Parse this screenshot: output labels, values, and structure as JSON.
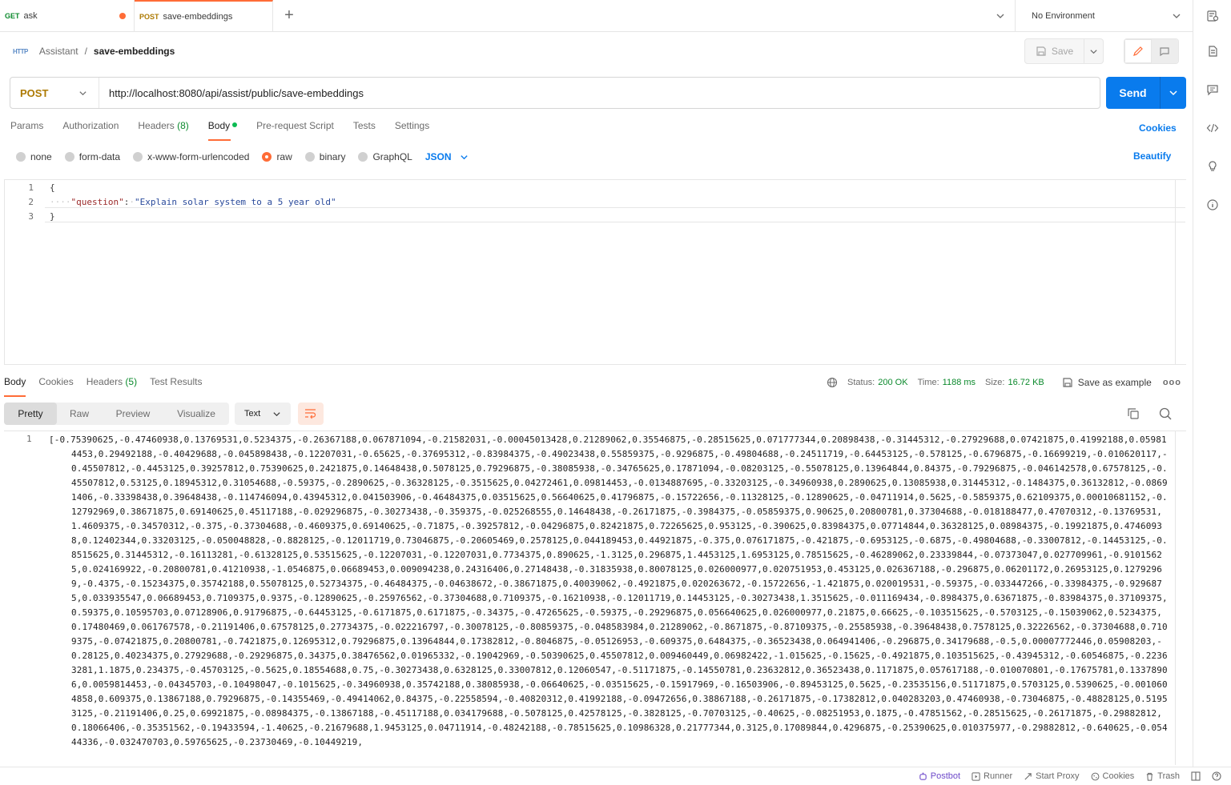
{
  "tabs": [
    {
      "method": "GET",
      "method_color": "#0c8a2d",
      "name": "ask"
    },
    {
      "method": "POST",
      "method_color": "#ad7a03",
      "name": "save-embeddings"
    }
  ],
  "environment": "No Environment",
  "breadcrumb": {
    "protocol_badge": "HTTP",
    "collection": "Assistant",
    "separator": "/",
    "request": "save-embeddings"
  },
  "toolbar": {
    "save_label": "Save"
  },
  "request": {
    "method": "POST",
    "url": "http://localhost:8080/api/assist/public/save-embeddings",
    "send_label": "Send"
  },
  "request_tabs": [
    {
      "label": "Params"
    },
    {
      "label": "Authorization"
    },
    {
      "label": "Headers",
      "count": "(8)"
    },
    {
      "label": "Body",
      "active": true
    },
    {
      "label": "Pre-request Script"
    },
    {
      "label": "Tests"
    },
    {
      "label": "Settings"
    }
  ],
  "cookies_link": "Cookies",
  "body_types": [
    "none",
    "form-data",
    "x-www-form-urlencoded",
    "raw",
    "binary",
    "GraphQL"
  ],
  "body_type_selected": "raw",
  "body_format": "JSON",
  "beautify_label": "Beautify",
  "editor_lines": [
    {
      "num": "1",
      "text": "{"
    },
    {
      "num": "2",
      "key": "\"question\"",
      "value": "\"Explain solar system to a 5 year old\""
    },
    {
      "num": "3",
      "text": "}"
    }
  ],
  "response_tabs": [
    {
      "label": "Body",
      "active": true
    },
    {
      "label": "Cookies"
    },
    {
      "label": "Headers",
      "count": "(5)"
    },
    {
      "label": "Test Results"
    }
  ],
  "response_status": {
    "status_label": "Status:",
    "status": "200 OK",
    "time_label": "Time:",
    "time": "1188 ms",
    "size_label": "Size:",
    "size": "16.72 KB",
    "save_example": "Save as example",
    "more": "ooo"
  },
  "response_views": [
    "Pretty",
    "Raw",
    "Preview",
    "Visualize"
  ],
  "response_format": "Text",
  "response_line_number": "1",
  "response_text": "[-0.75390625,-0.47460938,0.13769531,0.5234375,-0.26367188,0.067871094,-0.21582031,-0.00045013428,0.21289062,0.35546875,-0.28515625,0.071777344,0.20898438,-0.31445312,-0.27929688,0.07421875,0.41992188,0.059814453,0.29492188,-0.40429688,-0.045898438,-0.12207031,-0.65625,-0.37695312,-0.83984375,-0.49023438,0.55859375,-0.9296875,-0.49804688,-0.24511719,-0.64453125,-0.578125,-0.6796875,-0.16699219,-0.010620117,-0.45507812,-0.4453125,0.39257812,0.75390625,0.2421875,0.14648438,0.5078125,0.79296875,-0.38085938,-0.34765625,0.17871094,-0.08203125,-0.55078125,0.13964844,0.84375,-0.79296875,-0.046142578,0.67578125,-0.45507812,0.53125,0.18945312,0.31054688,-0.59375,-0.2890625,-0.36328125,-0.3515625,0.04272461,0.09814453,-0.0134887695,-0.33203125,-0.34960938,0.2890625,0.13085938,0.31445312,-0.1484375,0.36132812,-0.08691406,-0.33398438,0.39648438,-0.114746094,0.43945312,0.041503906,-0.46484375,0.03515625,0.56640625,0.41796875,-0.15722656,-0.11328125,-0.12890625,-0.04711914,0.5625,-0.5859375,0.62109375,0.00010681152,-0.12792969,0.38671875,0.69140625,0.45117188,-0.029296875,-0.30273438,-0.359375,-0.025268555,0.14648438,-0.26171875,-0.3984375,-0.05859375,0.90625,0.20800781,0.37304688,-0.018188477,0.47070312,-0.13769531,1.4609375,-0.34570312,-0.375,-0.37304688,-0.4609375,0.69140625,-0.71875,-0.39257812,-0.04296875,0.82421875,0.72265625,0.953125,-0.390625,0.83984375,0.07714844,0.36328125,0.08984375,-0.19921875,0.47460938,0.12402344,0.33203125,-0.050048828,-0.8828125,-0.12011719,0.73046875,-0.20605469,0.2578125,0.044189453,0.44921875,-0.375,0.076171875,-0.421875,-0.6953125,-0.6875,-0.49804688,-0.33007812,-0.14453125,-0.8515625,0.31445312,-0.16113281,-0.61328125,0.53515625,-0.12207031,-0.12207031,0.7734375,0.890625,-1.3125,0.296875,1.4453125,1.6953125,0.78515625,-0.46289062,0.23339844,-0.07373047,0.027709961,-0.91015625,0.024169922,-0.20800781,0.41210938,-1.0546875,0.06689453,0.009094238,0.24316406,0.27148438,-0.31835938,0.80078125,0.026000977,0.020751953,0.453125,0.026367188,-0.296875,0.06201172,0.26953125,0.12792969,-0.4375,-0.15234375,0.35742188,0.55078125,0.52734375,-0.46484375,-0.04638672,-0.38671875,0.40039062,-0.4921875,0.020263672,-0.15722656,-1.421875,0.020019531,-0.59375,-0.033447266,-0.33984375,-0.9296875,0.033935547,0.06689453,0.7109375,0.9375,-0.12890625,-0.25976562,-0.37304688,0.7109375,-0.16210938,-0.12011719,0.14453125,-0.30273438,1.3515625,-0.011169434,-0.8984375,0.63671875,-0.83984375,0.37109375,0.59375,0.10595703,0.07128906,0.91796875,-0.64453125,-0.6171875,0.6171875,-0.34375,-0.47265625,-0.59375,-0.29296875,0.056640625,0.026000977,0.21875,0.66625,-0.103515625,-0.5703125,-0.15039062,0.5234375,0.17480469,0.061767578,-0.21191406,0.67578125,0.27734375,-0.022216797,-0.30078125,-0.80859375,-0.048583984,0.21289062,-0.8671875,-0.87109375,-0.25585938,-0.39648438,0.7578125,0.32226562,-0.37304688,0.7109375,-0.07421875,0.20800781,-0.7421875,0.12695312,0.79296875,0.13964844,0.17382812,-0.8046875,-0.05126953,-0.609375,0.6484375,-0.36523438,0.064941406,-0.296875,0.34179688,-0.5,0.00007772446,0.05908203,-0.28125,0.40234375,0.27929688,-0.29296875,0.34375,0.38476562,0.01965332,-0.19042969,-0.50390625,0.45507812,0.009460449,0.06982422,-1.015625,-0.15625,-0.4921875,0.103515625,-0.43945312,-0.60546875,-0.22363281,1.1875,0.234375,-0.45703125,-0.5625,0.18554688,0.75,-0.30273438,0.6328125,0.33007812,0.12060547,-0.51171875,-0.14550781,0.23632812,0.36523438,0.1171875,0.057617188,-0.010070801,-0.17675781,0.13378906,0.0059814453,-0.04345703,-0.10498047,-0.1015625,-0.34960938,0.35742188,0.38085938,-0.06640625,-0.03515625,-0.15917969,-0.16503906,-0.89453125,0.5625,-0.23535156,0.51171875,0.5703125,0.5390625,-0.0010604858,0.609375,0.13867188,0.79296875,-0.14355469,-0.49414062,0.84375,-0.22558594,-0.40820312,0.41992188,-0.09472656,0.38867188,-0.26171875,-0.17382812,0.040283203,0.47460938,-0.73046875,-0.48828125,0.51953125,-0.21191406,0.25,0.69921875,-0.08984375,-0.13867188,-0.45117188,0.034179688,-0.5078125,0.42578125,-0.3828125,-0.70703125,-0.40625,-0.08251953,0.1875,-0.47851562,-0.28515625,-0.26171875,-0.29882812,0.18066406,-0.35351562,-0.19433594,-1.40625,-0.21679688,1.9453125,0.04711914,-0.48242188,-0.78515625,0.10986328,0.21777344,0.3125,0.17089844,0.4296875,-0.25390625,0.010375977,-0.29882812,-0.640625,-0.05444336,-0.032470703,0.59765625,-0.23730469,-0.10449219,",
  "footer": [
    "Postbot",
    "Runner",
    "Start Proxy",
    "Cookies",
    "Trash"
  ]
}
